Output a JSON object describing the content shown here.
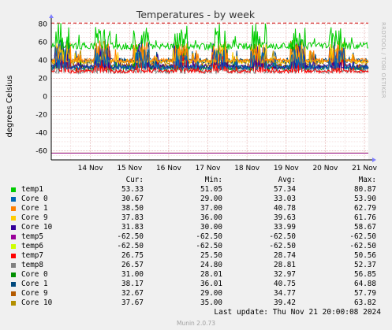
{
  "chart_data": {
    "type": "line",
    "title": "Temperatures - by week",
    "ylabel": "degrees Celsius",
    "ylim": [
      -70,
      82
    ],
    "yticks": [
      80,
      60,
      40,
      20,
      0,
      -20,
      -40,
      -60
    ],
    "yticks_labels": [
      "80",
      "60",
      "40",
      "20",
      "0",
      "-20",
      "-40",
      "-60"
    ],
    "xlim": [
      0,
      8.1
    ],
    "x_ticks": [
      {
        "label": "14 Nov",
        "x": 1
      },
      {
        "label": "15 Nov",
        "x": 2
      },
      {
        "label": "16 Nov",
        "x": 3
      },
      {
        "label": "17 Nov",
        "x": 4
      },
      {
        "label": "18 Nov",
        "x": 5
      },
      {
        "label": "19 Nov",
        "x": 6
      },
      {
        "label": "20 Nov",
        "x": 7
      },
      {
        "label": "21 Nov",
        "x": 8
      }
    ],
    "warning_line": 80.87,
    "grid": true,
    "side_text": "RRDTOOL / TOBI OETIKER",
    "series": [
      {
        "name": "temp1",
        "color": "#00cc00",
        "cur": "53.33",
        "min": "51.05",
        "avg": "57.34",
        "max": "80.87"
      },
      {
        "name": "Core 0",
        "color": "#0066b3",
        "cur": "30.67",
        "min": "29.00",
        "avg": "33.03",
        "max": "53.90"
      },
      {
        "name": "Core 1",
        "color": "#ff8000",
        "cur": "38.50",
        "min": "37.00",
        "avg": "40.78",
        "max": "62.79"
      },
      {
        "name": "Core 9",
        "color": "#ffcc00",
        "cur": "37.83",
        "min": "36.00",
        "avg": "39.63",
        "max": "61.76"
      },
      {
        "name": "Core 10",
        "color": "#330099",
        "cur": "31.83",
        "min": "30.00",
        "avg": "33.99",
        "max": "58.67"
      },
      {
        "name": "temp5",
        "color": "#990099",
        "cur": "-62.50",
        "min": "-62.50",
        "avg": "-62.50",
        "max": "-62.50"
      },
      {
        "name": "temp6",
        "color": "#ccff00",
        "cur": "-62.50",
        "min": "-62.50",
        "avg": "-62.50",
        "max": "-62.50"
      },
      {
        "name": "temp7",
        "color": "#ff0000",
        "cur": "26.75",
        "min": "25.50",
        "avg": "28.74",
        "max": "50.56"
      },
      {
        "name": "temp8",
        "color": "#808080",
        "cur": "26.57",
        "min": "24.80",
        "avg": "28.81",
        "max": "52.37"
      },
      {
        "name": "Core 0",
        "color": "#008f00",
        "cur": "31.00",
        "min": "28.01",
        "avg": "32.97",
        "max": "56.85"
      },
      {
        "name": "Core 1",
        "color": "#00487d",
        "cur": "38.17",
        "min": "36.01",
        "avg": "40.75",
        "max": "64.88"
      },
      {
        "name": "Core 9",
        "color": "#b35a00",
        "cur": "32.67",
        "min": "29.00",
        "avg": "34.77",
        "max": "57.79"
      },
      {
        "name": "Core 10",
        "color": "#b38f00",
        "cur": "37.67",
        "min": "35.00",
        "avg": "39.42",
        "max": "63.82"
      }
    ]
  },
  "legend": {
    "cur_label": "Cur:",
    "min_label": "Min:",
    "avg_label": "Avg:",
    "max_label": "Max:"
  },
  "last_update": "Last update: Thu Nov 21 20:00:08 2024",
  "version": "Munin 2.0.73"
}
